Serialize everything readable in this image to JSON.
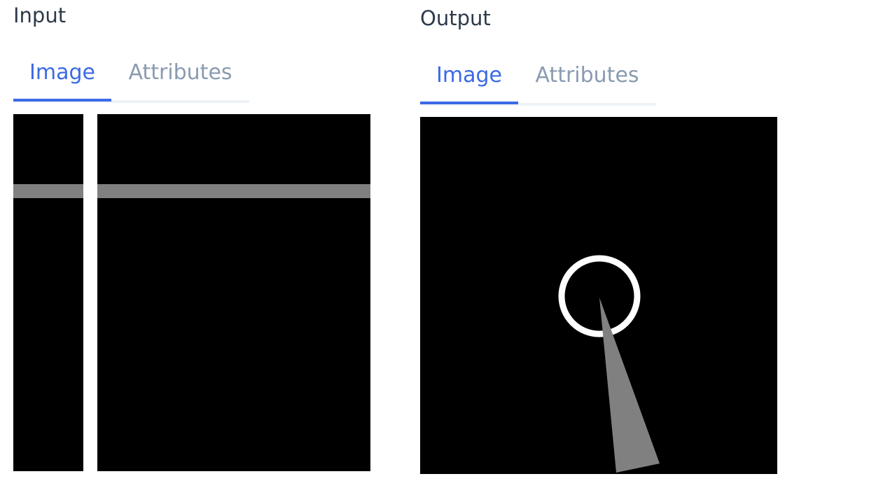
{
  "input_panel": {
    "title": "Input",
    "tabs": [
      {
        "label": "Image",
        "active": true
      },
      {
        "label": "Attributes",
        "active": false
      }
    ]
  },
  "output_panel": {
    "title": "Output",
    "tabs": [
      {
        "label": "Image",
        "active": true
      },
      {
        "label": "Attributes",
        "active": false
      }
    ]
  },
  "colors": {
    "active_tab": "#3b6ae6",
    "inactive_tab": "#8a9bb0",
    "title": "#2d3a4a",
    "canvas_bg": "#000000",
    "white_mark": "#ffffff",
    "gray_mark": "#808080"
  }
}
